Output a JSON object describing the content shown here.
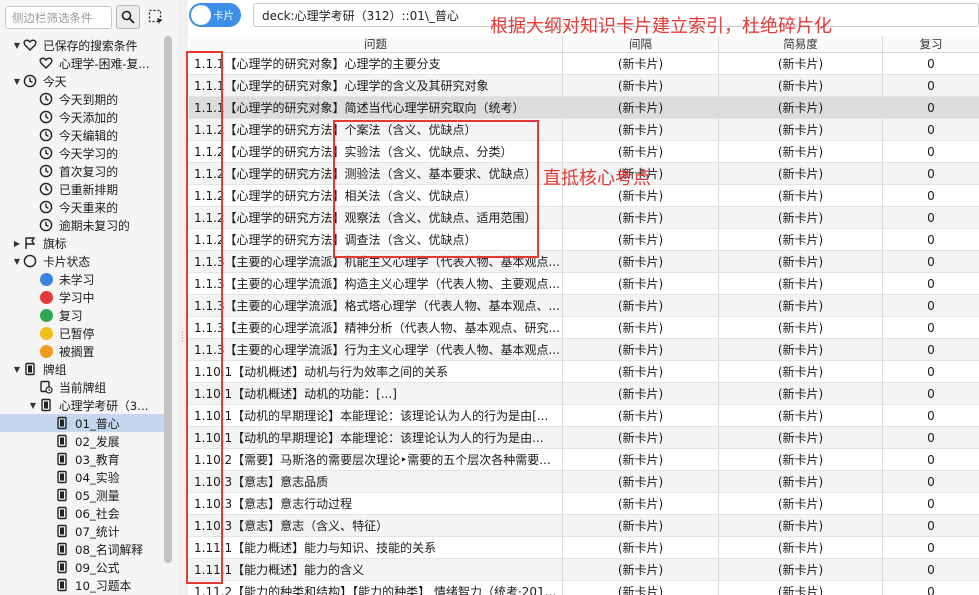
{
  "sidebar": {
    "search_placeholder": "侧边栏筛选条件",
    "tree": [
      {
        "level": 0,
        "twisty": "open",
        "icon": "heart-icon",
        "label": "已保存的搜索条件"
      },
      {
        "level": 1,
        "twisty": "",
        "icon": "heart-icon",
        "label": "心理学-困难-复..."
      },
      {
        "level": 0,
        "twisty": "open",
        "icon": "clock-icon",
        "label": "今天"
      },
      {
        "level": 1,
        "twisty": "",
        "icon": "clock-icon",
        "label": "今天到期的"
      },
      {
        "level": 1,
        "twisty": "",
        "icon": "clock-icon",
        "label": "今天添加的"
      },
      {
        "level": 1,
        "twisty": "",
        "icon": "clock-icon",
        "label": "今天编辑的"
      },
      {
        "level": 1,
        "twisty": "",
        "icon": "clock-icon",
        "label": "今天学习的"
      },
      {
        "level": 1,
        "twisty": "",
        "icon": "clock-icon",
        "label": "首次复习的"
      },
      {
        "level": 1,
        "twisty": "",
        "icon": "clock-icon",
        "label": "已重新排期"
      },
      {
        "level": 1,
        "twisty": "",
        "icon": "clock-icon",
        "label": "今天重来的"
      },
      {
        "level": 1,
        "twisty": "",
        "icon": "clock-icon",
        "label": "逾期未复习的"
      },
      {
        "level": 0,
        "twisty": "closed",
        "icon": "flag-icon",
        "label": "旗标"
      },
      {
        "level": 0,
        "twisty": "open",
        "icon": "circle-icon",
        "label": "卡片状态"
      },
      {
        "level": 1,
        "twisty": "",
        "icon": "dot",
        "color": "#3b82e0",
        "label": "未学习"
      },
      {
        "level": 1,
        "twisty": "",
        "icon": "dot",
        "color": "#e03a3a",
        "label": "学习中"
      },
      {
        "level": 1,
        "twisty": "",
        "icon": "dot",
        "color": "#2fa84f",
        "label": "复习"
      },
      {
        "level": 1,
        "twisty": "",
        "icon": "dot",
        "color": "#f2c01d",
        "label": "已暂停"
      },
      {
        "level": 1,
        "twisty": "",
        "icon": "dot",
        "color": "#f29a1d",
        "label": "被搁置"
      },
      {
        "level": 0,
        "twisty": "open",
        "icon": "deck-icon",
        "label": "牌组"
      },
      {
        "level": 1,
        "twisty": "",
        "icon": "current-deck-icon",
        "label": "当前牌组"
      },
      {
        "level": 1,
        "twisty": "open",
        "icon": "deck-icon",
        "label": "心理学考研（3..."
      },
      {
        "level": 2,
        "twisty": "",
        "icon": "deck-icon",
        "label": "01_普心",
        "selected": true
      },
      {
        "level": 2,
        "twisty": "",
        "icon": "deck-icon",
        "label": "02_发展"
      },
      {
        "level": 2,
        "twisty": "",
        "icon": "deck-icon",
        "label": "03_教育"
      },
      {
        "level": 2,
        "twisty": "",
        "icon": "deck-icon",
        "label": "04_实验"
      },
      {
        "level": 2,
        "twisty": "",
        "icon": "deck-icon",
        "label": "05_测量"
      },
      {
        "level": 2,
        "twisty": "",
        "icon": "deck-icon",
        "label": "06_社会"
      },
      {
        "level": 2,
        "twisty": "",
        "icon": "deck-icon",
        "label": "07_统计"
      },
      {
        "level": 2,
        "twisty": "",
        "icon": "deck-icon",
        "label": "08_名词解释"
      },
      {
        "level": 2,
        "twisty": "",
        "icon": "deck-icon",
        "label": "09_公式"
      },
      {
        "level": 2,
        "twisty": "",
        "icon": "deck-icon",
        "label": "10_习题本"
      }
    ]
  },
  "toolbar": {
    "toggle_label": "卡片",
    "query": "deck:心理学考研（312）::01\\_普心"
  },
  "table": {
    "columns": [
      "问题",
      "间隔",
      "简易度",
      "复习"
    ],
    "rows": [
      {
        "q": "1.1.1【心理学的研究对象】心理学的主要分支",
        "i": "(新卡片)",
        "e": "(新卡片)",
        "r": "0"
      },
      {
        "q": "1.1.1【心理学的研究对象】心理学的含义及其研究对象",
        "i": "(新卡片)",
        "e": "(新卡片)",
        "r": "0"
      },
      {
        "q": "1.1.1【心理学的研究对象】简述当代心理学研究取向（统考）",
        "i": "(新卡片)",
        "e": "(新卡片)",
        "r": "0",
        "selected": true
      },
      {
        "q": "1.1.2【心理学的研究方法】个案法（含义、优缺点）",
        "i": "(新卡片)",
        "e": "(新卡片)",
        "r": "0"
      },
      {
        "q": "1.1.2【心理学的研究方法】实验法（含义、优缺点、分类）",
        "i": "(新卡片)",
        "e": "(新卡片)",
        "r": "0"
      },
      {
        "q": "1.1.2【心理学的研究方法】测验法（含义、基本要求、优缺点）",
        "i": "(新卡片)",
        "e": "(新卡片)",
        "r": "0"
      },
      {
        "q": "1.1.2【心理学的研究方法】相关法（含义、优缺点）",
        "i": "(新卡片)",
        "e": "(新卡片)",
        "r": "0"
      },
      {
        "q": "1.1.2【心理学的研究方法】观察法（含义、优缺点、适用范围）",
        "i": "(新卡片)",
        "e": "(新卡片)",
        "r": "0"
      },
      {
        "q": "1.1.2【心理学的研究方法】调查法（含义、优缺点）",
        "i": "(新卡片)",
        "e": "(新卡片)",
        "r": "0"
      },
      {
        "q": "1.1.3【主要的心理学流派】机能主义心理学（代表人物、基本观点...",
        "i": "(新卡片)",
        "e": "(新卡片)",
        "r": "0"
      },
      {
        "q": "1.1.3【主要的心理学流派】构造主义心理学（代表人物、主要观点...",
        "i": "(新卡片)",
        "e": "(新卡片)",
        "r": "0"
      },
      {
        "q": "1.1.3【主要的心理学流派】格式塔心理学（代表人物、基本观点、...",
        "i": "(新卡片)",
        "e": "(新卡片)",
        "r": "0"
      },
      {
        "q": "1.1.3【主要的心理学流派】精神分析（代表人物、基本观点、研究...",
        "i": "(新卡片)",
        "e": "(新卡片)",
        "r": "0"
      },
      {
        "q": "1.1.3【主要的心理学流派】行为主义心理学（代表人物、基本观点...",
        "i": "(新卡片)",
        "e": "(新卡片)",
        "r": "0"
      },
      {
        "q": "1.10.1【动机概述】动机与行为效率之间的关系",
        "i": "(新卡片)",
        "e": "(新卡片)",
        "r": "0"
      },
      {
        "q": "1.10.1【动机概述】动机的功能：[...]",
        "i": "(新卡片)",
        "e": "(新卡片)",
        "r": "0"
      },
      {
        "q": "1.10.1【动机的早期理论】本能理论：该理论认为人的行为是由[...",
        "i": "(新卡片)",
        "e": "(新卡片)",
        "r": "0"
      },
      {
        "q": "1.10.1【动机的早期理论】本能理论：该理论认为人的行为是由...",
        "i": "(新卡片)",
        "e": "(新卡片)",
        "r": "0"
      },
      {
        "q": "1.10.2【需要】马斯洛的需要层次理论‣需要的五个层次各种需要...",
        "i": "(新卡片)",
        "e": "(新卡片)",
        "r": "0"
      },
      {
        "q": "1.10.3【意志】意志品质",
        "i": "(新卡片)",
        "e": "(新卡片)",
        "r": "0"
      },
      {
        "q": "1.10.3【意志】意志行动过程",
        "i": "(新卡片)",
        "e": "(新卡片)",
        "r": "0"
      },
      {
        "q": "1.10.3【意志】意志（含义、特征）",
        "i": "(新卡片)",
        "e": "(新卡片)",
        "r": "0"
      },
      {
        "q": "1.11.1【能力概述】能力与知识、技能的关系",
        "i": "(新卡片)",
        "e": "(新卡片)",
        "r": "0"
      },
      {
        "q": "1.11.1【能力概述】能力的含义",
        "i": "(新卡片)",
        "e": "(新卡片)",
        "r": "0"
      },
      {
        "q": "1.11.2【能力的种类和结构】【能力的种类】 情绪智力（统考·201...",
        "i": "(新卡片)",
        "e": "(新卡片)",
        "r": "0"
      }
    ]
  },
  "annotations": {
    "title": "根据大纲对知识卡片建立索引，杜绝碎片化",
    "core": "直抵核心考点",
    "color": "#e53935"
  }
}
